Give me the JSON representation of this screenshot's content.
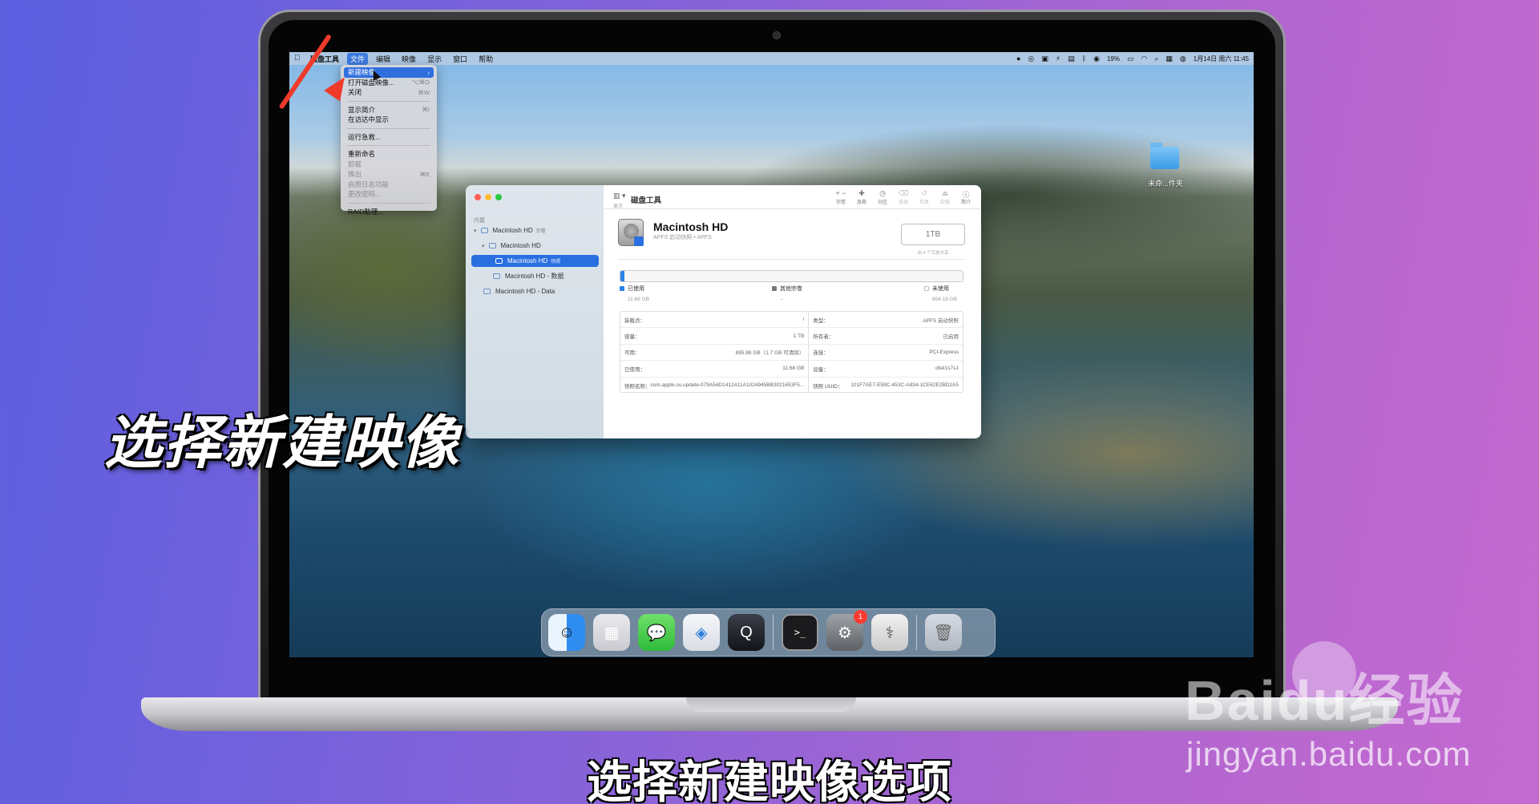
{
  "menubar": {
    "app": "磁盘工具",
    "items": [
      "文件",
      "编辑",
      "映像",
      "显示",
      "窗口",
      "帮助"
    ],
    "battery": "19%",
    "datetime": "1月14日 周六 11:45"
  },
  "file_menu": {
    "items": [
      {
        "label": "新建映像",
        "shortcut": "›",
        "state": "highlight"
      },
      {
        "label": "打开磁盘映像...",
        "shortcut": "⌥⌘O",
        "state": "normal"
      },
      {
        "label": "关闭",
        "shortcut": "⌘W",
        "state": "normal"
      },
      {
        "label": "显示简介",
        "shortcut": "⌘I",
        "state": "normal"
      },
      {
        "label": "在访达中显示",
        "shortcut": "",
        "state": "normal"
      },
      {
        "label": "运行急救...",
        "shortcut": "",
        "state": "normal"
      },
      {
        "label": "重新命名",
        "shortcut": "",
        "state": "normal"
      },
      {
        "label": "卸载",
        "shortcut": "",
        "state": "disabled"
      },
      {
        "label": "推出",
        "shortcut": "⌘E",
        "state": "disabled"
      },
      {
        "label": "启用日志功能",
        "shortcut": "",
        "state": "disabled"
      },
      {
        "label": "更改密码...",
        "shortcut": "",
        "state": "disabled"
      },
      {
        "label": "RAID助理...",
        "shortcut": "",
        "state": "normal"
      }
    ]
  },
  "disk_utility": {
    "title": "磁盘工具",
    "view_label": "显示",
    "sidebar_header": "内置",
    "sidebar_items": [
      {
        "label": "Macintosh HD",
        "tag": "宗卷"
      },
      {
        "label": "Macintosh HD",
        "tag": ""
      },
      {
        "label": "Macintosh HD",
        "tag": "快照"
      },
      {
        "label": "Macintosh HD - 数据",
        "tag": ""
      },
      {
        "label": "Macintosh HD - Data",
        "tag": ""
      }
    ],
    "toolbar_buttons": [
      {
        "label": "宗卷",
        "glyph": "+ −",
        "enabled": true
      },
      {
        "label": "急救",
        "glyph": "✚",
        "enabled": true
      },
      {
        "label": "分区",
        "glyph": "◷",
        "enabled": true
      },
      {
        "label": "抹掉",
        "glyph": "⌫",
        "enabled": false
      },
      {
        "label": "恢复",
        "glyph": "↺",
        "enabled": false
      },
      {
        "label": "卸载",
        "glyph": "⏏",
        "enabled": false
      },
      {
        "label": "简介",
        "glyph": "ⓘ",
        "enabled": true
      }
    ],
    "volume_name": "Macintosh HD",
    "volume_subtitle": "APFS 启动快照 • APFS",
    "capacity_box": "1TB",
    "capacity_note": "由 4 个宗卷共享",
    "usage_fraction": 0.012,
    "legend": [
      {
        "label": "已使用",
        "value": "11.68 GB",
        "color": "#2a83e6"
      },
      {
        "label": "其他宗卷",
        "value": "--",
        "color": "#777777"
      },
      {
        "label": "未使用",
        "value": "894.18 GB",
        "color": "#ffffff"
      }
    ],
    "info_left": [
      {
        "key": "装载点：",
        "value": "/"
      },
      {
        "key": "容量：",
        "value": "1 TB"
      },
      {
        "key": "可用：",
        "value": "895.88 GB（1.7 GB 可清除）"
      },
      {
        "key": "已使用：",
        "value": "11.68 GB"
      },
      {
        "key": "快照名称：",
        "value": "com.apple.os.update-079A54D1412A11A1024945BB3021653F5..."
      }
    ],
    "info_right": [
      {
        "key": "类型：",
        "value": "APFS 启动快照"
      },
      {
        "key": "所有者：",
        "value": "已启用"
      },
      {
        "key": "连接：",
        "value": "PCI-Express"
      },
      {
        "key": "设备：",
        "value": "disk1s7s1"
      },
      {
        "key": "快照 UUID：",
        "value": "101F7AE7-E59C-453C-A834-1CE62E2BD2A5"
      }
    ]
  },
  "desktop": {
    "folder_label": "未命...件夹"
  },
  "dock": {
    "apps": [
      "finder",
      "launchpad",
      "messages",
      "safari",
      "quicktime",
      "terminal",
      "system-preferences",
      "disk-utility",
      "trash"
    ],
    "settings_badge": "1",
    "terminal_glyph": ">_"
  },
  "overlay": {
    "big_caption": "选择新建映像",
    "subtitle": "选择新建映像选项",
    "watermark_logo": "Baidu经验",
    "watermark_url": "jingyan.baidu.com",
    "arrow_color": "#f03a2a"
  }
}
